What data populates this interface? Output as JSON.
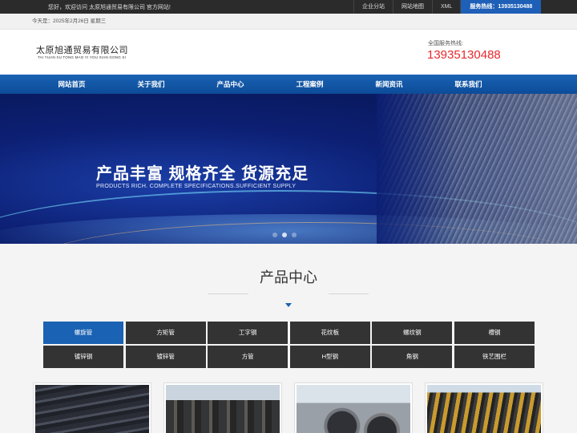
{
  "topbar": {
    "welcome": "您好，欢迎访问 太原旭通贸易有限公司 官方网站!",
    "links": [
      "企业分站",
      "网站地图",
      "XML"
    ],
    "hotline": "服务热线：13935130488"
  },
  "datebar": {
    "text": "今天是：2025年2月26日 星期三"
  },
  "header": {
    "logo_cn": "太原旭通贸易有限公司",
    "logo_en": "TAI YUAN XU TONG MAO YI  YOU XIAN GONG SI",
    "hotline_label": "全国服务热线:",
    "hotline_number": "13935130488"
  },
  "nav": [
    "网站首页",
    "关于我们",
    "产品中心",
    "工程案例",
    "新闻资讯",
    "联系我们"
  ],
  "banner": {
    "slogan": "产品丰富 规格齐全 货源充足",
    "slogan_en": "PRODUCTS RICH. COMPLETE SPECIFICATIONS.SUFFICIENT SUPPLY",
    "slides": 3,
    "active_slide": 2
  },
  "products": {
    "title": "产品中心",
    "categories": [
      "螺旋管",
      "方矩管",
      "工字钢",
      "花纹板",
      "螺纹钢",
      "槽钢",
      "镀锌钢",
      "镀锌管",
      "方管",
      "H型钢",
      "角钢",
      "铁艺围栏"
    ],
    "active_category": "螺旋管"
  },
  "colors": {
    "brand_blue": "#1a62b3",
    "hotline_red": "#e8292d",
    "dark": "#333333"
  }
}
